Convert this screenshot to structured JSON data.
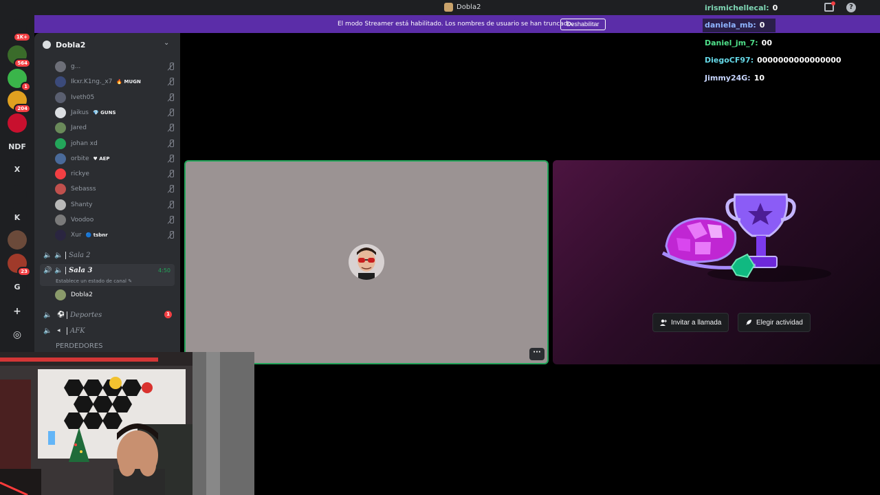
{
  "window": {
    "title": "Dobla2"
  },
  "guilds": [
    {
      "label": "",
      "badge": "1K+",
      "color": "#1e1f22"
    },
    {
      "label": "",
      "badge": "564",
      "color": "#3a6b2a"
    },
    {
      "label": "",
      "badge": "1",
      "color": "#3ab54a"
    },
    {
      "label": "",
      "badge": "204",
      "color": "#e0a020"
    },
    {
      "label": "",
      "badge": "",
      "color": "#c8102e"
    },
    {
      "label": "NDF",
      "badge": "",
      "color": "#1e1f22"
    },
    {
      "label": "X",
      "badge": "",
      "color": "#1e1f22"
    },
    {
      "label": "",
      "badge": "",
      "color": "#1e1f22"
    },
    {
      "label": "K",
      "badge": "",
      "color": "#1e1f22"
    },
    {
      "label": "",
      "badge": "",
      "color": "#6b4a3a"
    },
    {
      "label": "",
      "badge": "23",
      "color": "#a03a2a"
    },
    {
      "label": "G",
      "badge": "",
      "color": "#1e1f22"
    }
  ],
  "banner": {
    "text": "El modo Streamer está habilitado. Los nombres de usuario se han truncado.",
    "button": "Deshabilitar"
  },
  "server": {
    "name": "Dobla2"
  },
  "members": [
    {
      "name": "g...",
      "tag": "",
      "color": "#6d6f78"
    },
    {
      "name": "Ikxr.K1ng._x7",
      "tag": "🔥 MUGN",
      "color": "#3b4a7a"
    },
    {
      "name": "Iveth05",
      "tag": "",
      "color": "#5a5f70"
    },
    {
      "name": "Jaikus",
      "tag": "💎 GUNS",
      "color": "#dbdee1"
    },
    {
      "name": "Jared",
      "tag": "",
      "color": "#6a8a5a"
    },
    {
      "name": "johan xd",
      "tag": "",
      "color": "#23a55a"
    },
    {
      "name": "orbite",
      "tag": "♥ AEP",
      "color": "#4a6a9a"
    },
    {
      "name": "rickye",
      "tag": "",
      "color": "#f23f43"
    },
    {
      "name": "Sebasss",
      "tag": "",
      "color": "#c0504d"
    },
    {
      "name": "Shanty",
      "tag": "",
      "color": "#b8b8b8"
    },
    {
      "name": "Voodoo",
      "tag": "",
      "color": "#7a7a7a"
    },
    {
      "name": "Xur",
      "tag": "🔵 tsbnr",
      "color": "#2a2540"
    }
  ],
  "channels": {
    "sala2": {
      "name": "Sala 2"
    },
    "sala3": {
      "name": "Sala 3",
      "time": "4:50",
      "status": "Establece un estado de canal"
    },
    "sala3_member": {
      "name": "Dobla2"
    },
    "deportes": {
      "emoji": "⚽",
      "name": "Deportes",
      "badge": "1"
    },
    "afk": {
      "emoji": "",
      "name": "AFK"
    },
    "perdedores": {
      "name": "PERDEDORES"
    }
  },
  "activity": {
    "invite_button": "Invitar a llamada",
    "choose_button": "Elegir actividad"
  },
  "leaderboard": [
    {
      "user": "irismichellecal:",
      "value": "0",
      "color": "#7fd6b4"
    },
    {
      "user": "daniela_mb:",
      "value": "0",
      "color": "#8fb4ff"
    },
    {
      "user": "Daniel_jm_7:",
      "value": "00",
      "color": "#4fe08a"
    },
    {
      "user": "DiegoCF97:",
      "value": "0000000000000000",
      "color": "#66d9e8"
    },
    {
      "user": "Jimmy24G:",
      "value": "10",
      "color": "#c8d6ff"
    }
  ]
}
